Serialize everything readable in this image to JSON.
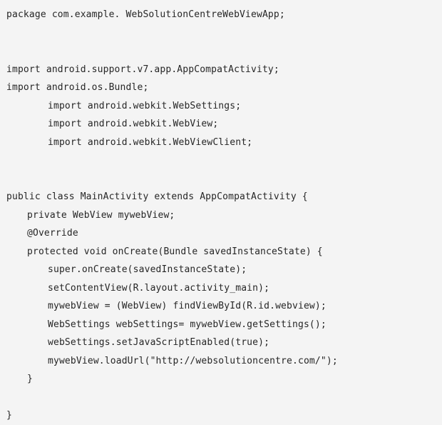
{
  "document": {
    "kind": "source-code-listing",
    "language": "Java",
    "background_color": "#f4f4f4",
    "text_color": "#262626"
  },
  "code": {
    "lines": [
      {
        "text": "package com.example. WebSolutionCentreWebViewApp;",
        "indent": 0
      },
      {
        "text": "",
        "indent": 0
      },
      {
        "text": "",
        "indent": 0
      },
      {
        "text": "import android.support.v7.app.AppCompatActivity;",
        "indent": 0
      },
      {
        "text": "import android.os.Bundle;",
        "indent": 0
      },
      {
        "text": "import android.webkit.WebSettings;",
        "indent": 2
      },
      {
        "text": "import android.webkit.WebView;",
        "indent": 2
      },
      {
        "text": "import android.webkit.WebViewClient;",
        "indent": 2
      },
      {
        "text": "",
        "indent": 0
      },
      {
        "text": "",
        "indent": 0
      },
      {
        "text": "public class MainActivity extends AppCompatActivity {",
        "indent": 0
      },
      {
        "text": "private WebView mywebView;",
        "indent": 1
      },
      {
        "text": "@Override",
        "indent": 1
      },
      {
        "text": "protected void onCreate(Bundle savedInstanceState) {",
        "indent": 1
      },
      {
        "text": "super.onCreate(savedInstanceState);",
        "indent": 2
      },
      {
        "text": "setContentView(R.layout.activity_main);",
        "indent": 2
      },
      {
        "text": "mywebView = (WebView) findViewById(R.id.webview);",
        "indent": 2
      },
      {
        "text": "WebSettings webSettings= mywebView.getSettings();",
        "indent": 2
      },
      {
        "text": "webSettings.setJavaScriptEnabled(true);",
        "indent": 2
      },
      {
        "text": "mywebView.loadUrl(\"http://websolutioncentre.com/\");",
        "indent": 2
      },
      {
        "text": "}",
        "indent": 1
      },
      {
        "text": "",
        "indent": 0
      },
      {
        "text": "}",
        "indent": 0
      }
    ]
  }
}
